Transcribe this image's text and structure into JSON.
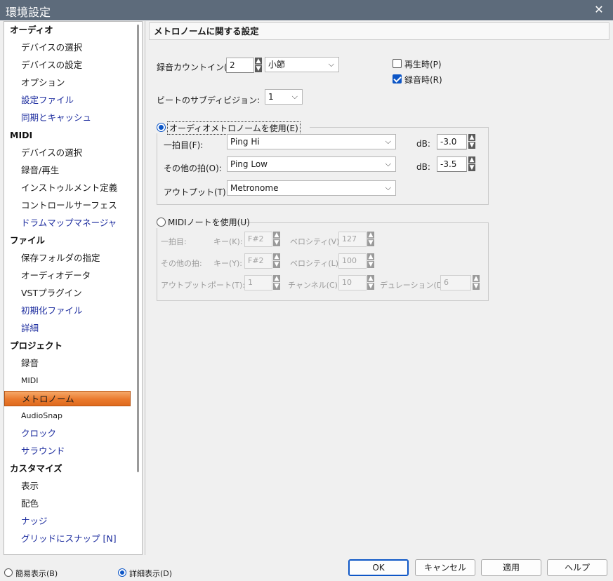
{
  "window": {
    "title": "環境設定",
    "close": "✕"
  },
  "sidebar": {
    "items": [
      {
        "label": "オーディオ",
        "type": "cat"
      },
      {
        "label": "デバイスの選択",
        "type": "sub"
      },
      {
        "label": "デバイスの設定",
        "type": "sub"
      },
      {
        "label": "オプション",
        "type": "sub"
      },
      {
        "label": "設定ファイル",
        "type": "link"
      },
      {
        "label": "同期とキャッシュ",
        "type": "link"
      },
      {
        "label": "MIDI",
        "type": "cat"
      },
      {
        "label": "デバイスの選択",
        "type": "sub"
      },
      {
        "label": "録音/再生",
        "type": "sub"
      },
      {
        "label": "インストゥルメント定義",
        "type": "sub"
      },
      {
        "label": "コントロールサーフェス",
        "type": "sub"
      },
      {
        "label": "ドラムマップマネージャ",
        "type": "link"
      },
      {
        "label": "ファイル",
        "type": "cat"
      },
      {
        "label": "保存フォルダの指定",
        "type": "sub"
      },
      {
        "label": "オーディオデータ",
        "type": "sub"
      },
      {
        "label": "VSTプラグイン",
        "type": "sub"
      },
      {
        "label": "初期化ファイル",
        "type": "link"
      },
      {
        "label": "詳細",
        "type": "link"
      },
      {
        "label": "プロジェクト",
        "type": "cat"
      },
      {
        "label": "録音",
        "type": "sub"
      },
      {
        "label": "MIDI",
        "type": "small"
      },
      {
        "label": "メトロノーム",
        "type": "selected"
      },
      {
        "label": "AudioSnap",
        "type": "small"
      },
      {
        "label": "クロック",
        "type": "link"
      },
      {
        "label": "サラウンド",
        "type": "link"
      },
      {
        "label": "カスタマイズ",
        "type": "cat"
      },
      {
        "label": "表示",
        "type": "sub"
      },
      {
        "label": "配色",
        "type": "sub"
      },
      {
        "label": "ナッジ",
        "type": "link"
      },
      {
        "label": "グリッドにスナップ [N]",
        "type": "link"
      }
    ],
    "simple_view": "簡易表示(B)",
    "detail_view": "詳細表示(D)"
  },
  "main": {
    "header": "メトロノームに関する設定",
    "count_in_label": "録音カウントイン(I):",
    "count_in_value": "2",
    "count_in_unit": "小節",
    "playback_label": "再生時(P)",
    "recording_label": "録音時(R)",
    "subdivision_label": "ビートのサブディビジョン:",
    "subdivision_value": "1",
    "audio_metronome": {
      "label": "オーディオメトロノームを使用(E)",
      "first_beat_label": "一拍目(F):",
      "first_beat_value": "Ping Hi",
      "other_beat_label": "その他の拍(O):",
      "other_beat_value": "Ping Low",
      "output_label": "アウトプット(T):",
      "output_value": "Metronome",
      "db_label": "dB:",
      "first_db": "-3.0",
      "other_db": "-3.5"
    },
    "midi_note": {
      "label": "MIDIノートを使用(U)",
      "first_beat_label": "一拍目:",
      "other_beat_label": "その他の拍:",
      "output_label": "アウトプット:",
      "key_label_1": "キー(K):",
      "key_label_2": "キー(Y):",
      "key_1": "F#2",
      "key_2": "F#2",
      "velocity_label_1": "ベロシティ(V):",
      "velocity_label_2": "ベロシティ(L):",
      "velocity_1": "127",
      "velocity_2": "100",
      "port_label": "ポート(T):",
      "port_value": "1",
      "channel_label": "チャンネル(C):",
      "channel_value": "10",
      "duration_label": "デュレーション(D):",
      "duration_value": "6"
    }
  },
  "buttons": {
    "ok": "OK",
    "cancel": "キャンセル",
    "apply": "適用",
    "help": "ヘルプ"
  },
  "colors": {
    "titlebar": "#5d6b7b",
    "accent": "#0d56c6",
    "selected": "#ea7a2e",
    "link": "#1b2b9e"
  }
}
